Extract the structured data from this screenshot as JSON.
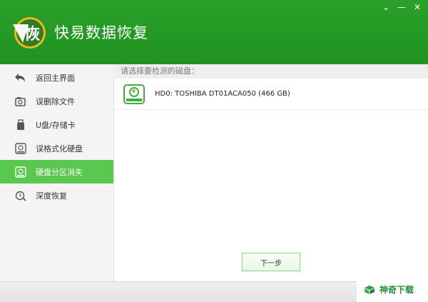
{
  "app": {
    "title": "快易数据恢复",
    "logo_char": "恢"
  },
  "window_controls": {
    "minimize": "⌄",
    "restore": "—",
    "close": "✕"
  },
  "sidebar": {
    "items": [
      {
        "label": "返回主界面",
        "icon": "back-arrow-icon",
        "active": false
      },
      {
        "label": "误删除文件",
        "icon": "deleted-file-icon",
        "active": false
      },
      {
        "label": "U盘/存储卡",
        "icon": "usb-drive-icon",
        "active": false
      },
      {
        "label": "误格式化硬盘",
        "icon": "format-disk-icon",
        "active": false
      },
      {
        "label": "硬盘分区消失",
        "icon": "partition-disk-icon",
        "active": true
      },
      {
        "label": "深度恢复",
        "icon": "deep-recovery-icon",
        "active": false
      }
    ]
  },
  "main": {
    "prompt": "请选择要检测的磁盘：",
    "disks": [
      {
        "label": "HD0: TOSHIBA DT01ACA050 (466 GB)",
        "icon": "hard-disk-icon"
      }
    ],
    "next_button": "下一步"
  },
  "watermark": {
    "text": "神奇下载",
    "logo": "box-icon"
  },
  "colors": {
    "header_green": "#23992a",
    "active_green": "#5ac74f"
  }
}
